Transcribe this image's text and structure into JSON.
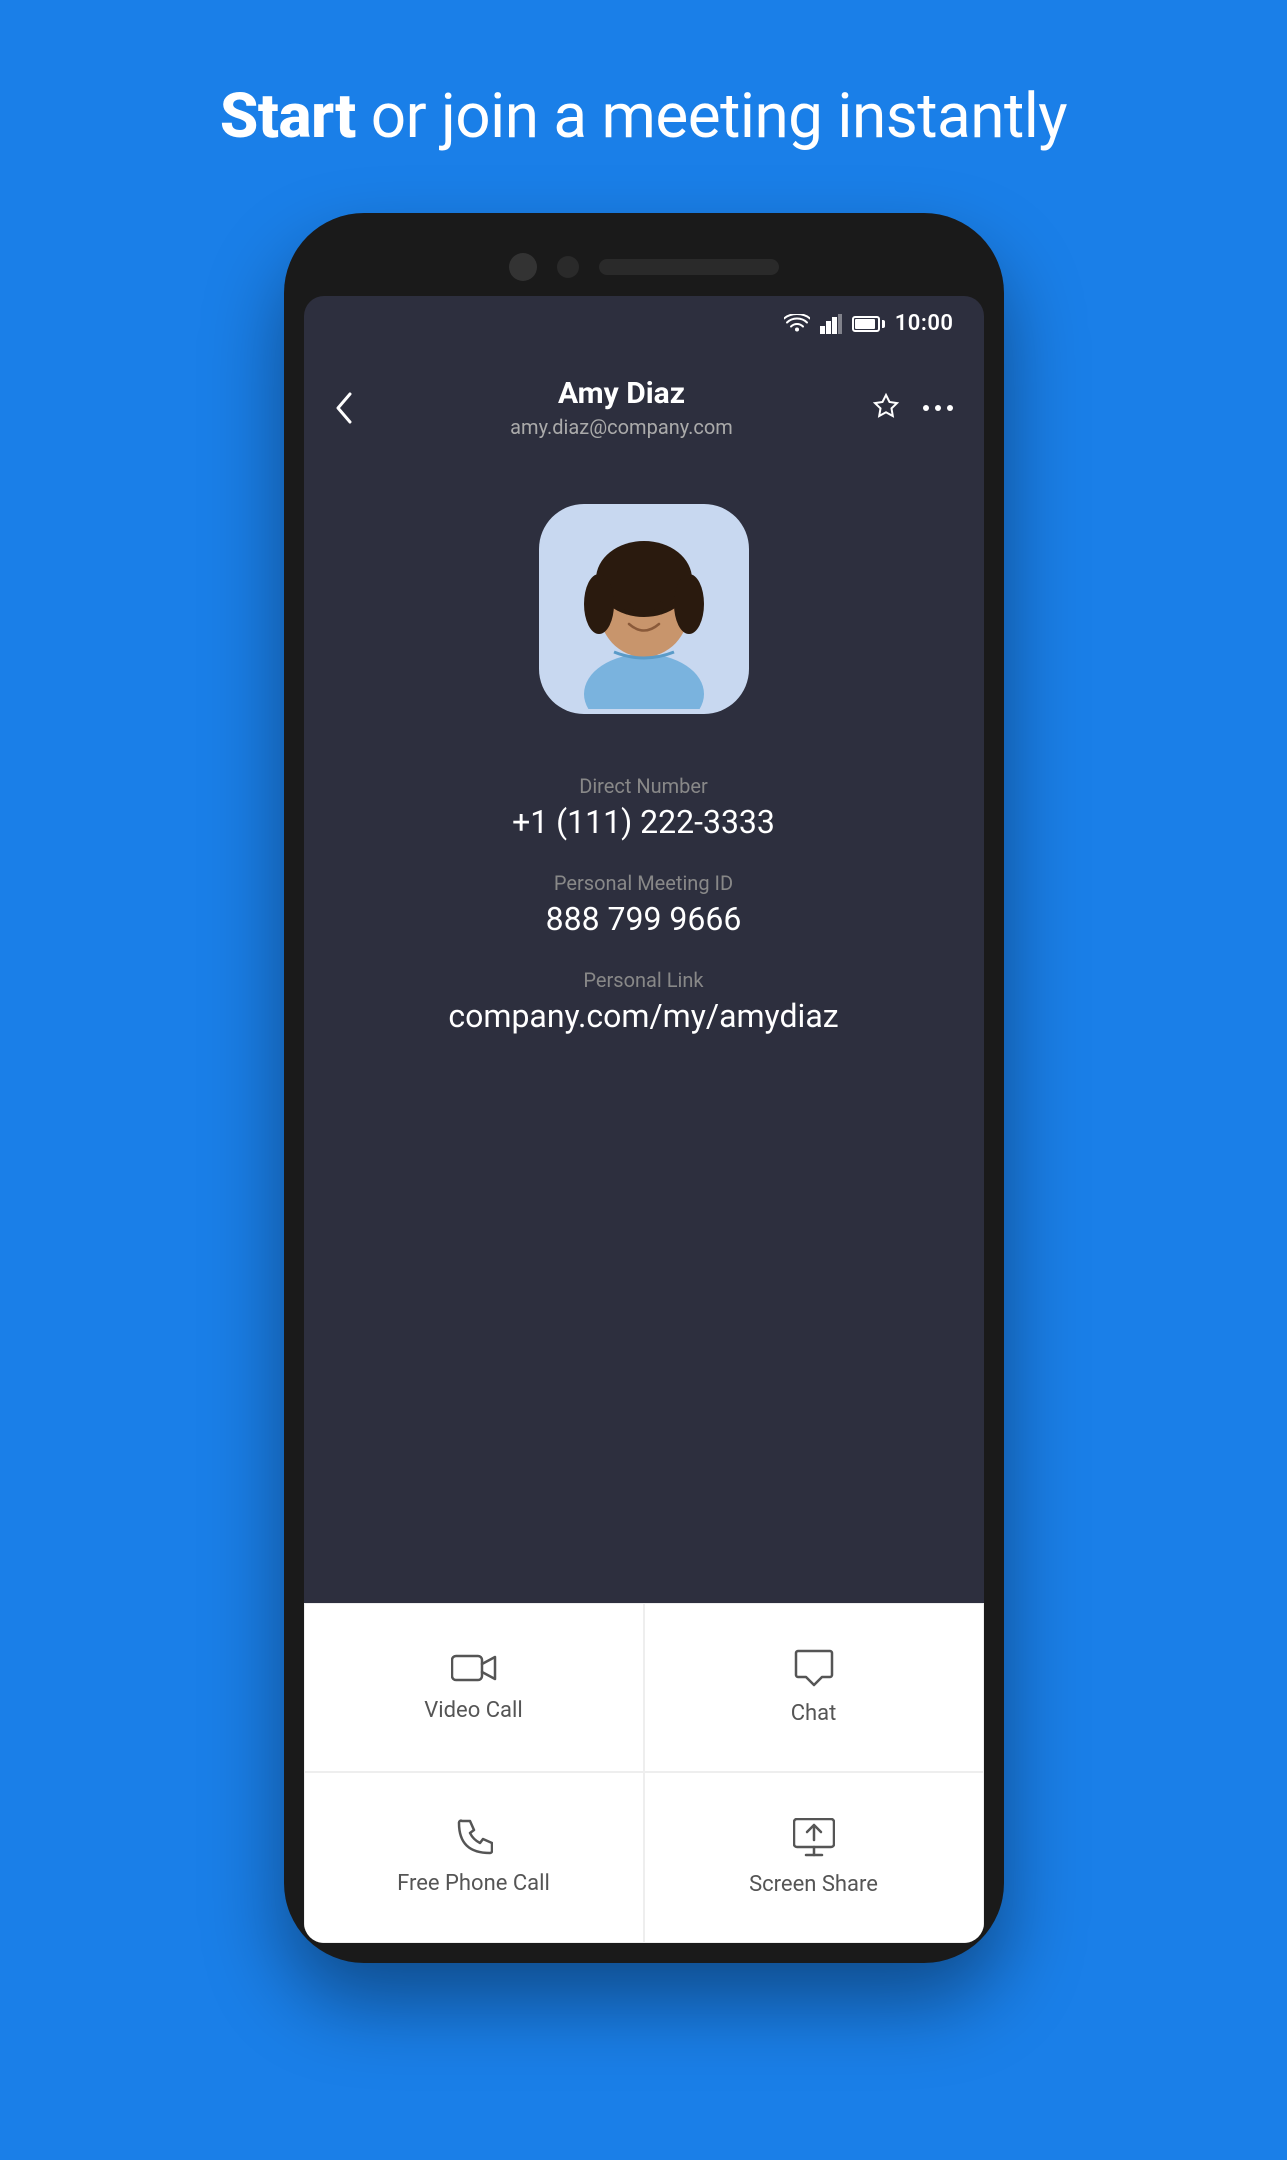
{
  "hero": {
    "text_bold": "Start",
    "text_regular": " or join a meeting instantly"
  },
  "status_bar": {
    "time": "10:00"
  },
  "contact": {
    "name": "Amy Diaz",
    "email": "amy.diaz@company.com",
    "direct_number_label": "Direct Number",
    "direct_number": "+1 (111) 222-3333",
    "meeting_id_label": "Personal Meeting ID",
    "meeting_id": "888 799 9666",
    "personal_link_label": "Personal Link",
    "personal_link": "company.com/my/amydiaz"
  },
  "actions": {
    "video_call_label": "Video Call",
    "chat_label": "Chat",
    "phone_call_label": "Free Phone Call",
    "screen_share_label": "Screen Share"
  }
}
